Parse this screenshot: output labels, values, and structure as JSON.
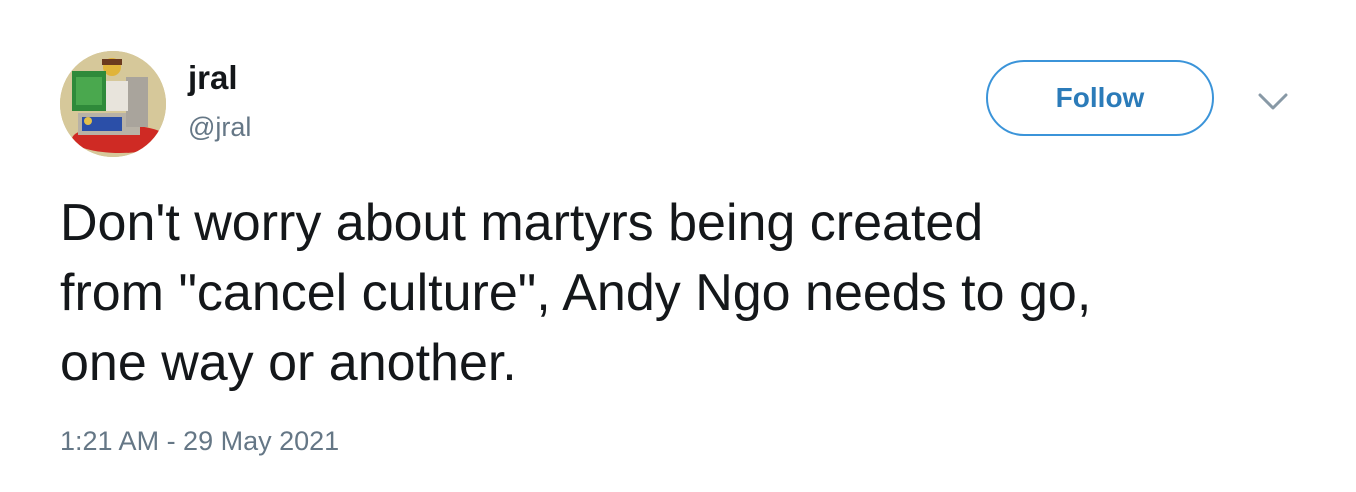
{
  "author": {
    "display_name": "jral",
    "handle": "@jral",
    "avatar_icon": "lego-figure-avatar-icon"
  },
  "follow_button": {
    "label": "Follow",
    "color": "#2b7bb9"
  },
  "menu": {
    "icon": "chevron-down-icon"
  },
  "tweet": {
    "text": "Don't worry about martyrs being created\nfrom \"cancel culture\", Andy Ngo needs to go,\none way or another.",
    "timestamp": "1:21 AM - 29 May 2021"
  }
}
